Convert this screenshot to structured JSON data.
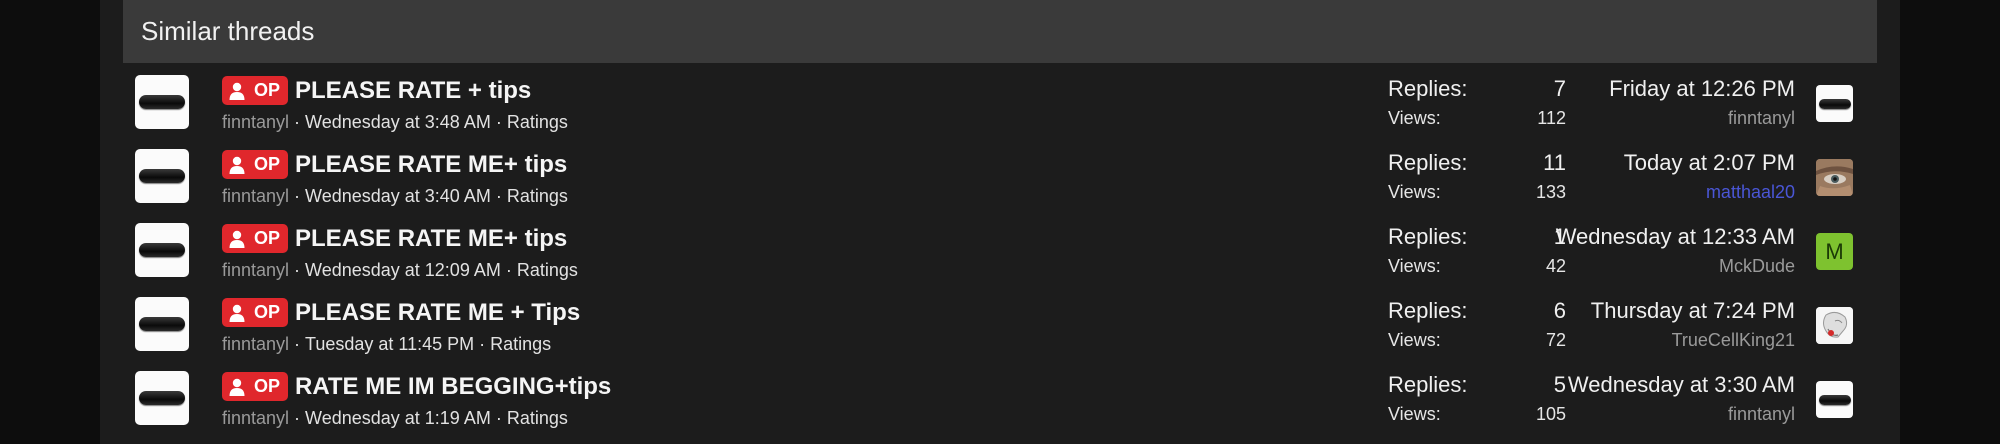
{
  "block": {
    "title": "Similar threads"
  },
  "badge_text": "OP",
  "labels": {
    "replies": "Replies:",
    "views": "Views:"
  },
  "colors": {
    "badge": "#e0272c",
    "highlight_user": "#4a56d6",
    "avatar_letter_bg": "#7ec22f"
  },
  "threads": [
    {
      "title": "PLEASE RATE + tips",
      "author": "finntanyl",
      "date": "Wednesday at 3:48 AM",
      "forum": "Ratings",
      "replies": "7",
      "views": "112",
      "last_date": "Friday at 12:26 PM",
      "last_user": "finntanyl",
      "last_avatar": "pill-image"
    },
    {
      "title": "PLEASE RATE ME+ tips",
      "author": "finntanyl",
      "date": "Wednesday at 3:40 AM",
      "forum": "Ratings",
      "replies": "11",
      "views": "133",
      "last_date": "Today at 2:07 PM",
      "last_user": "matthaal20",
      "last_avatar": "eye-photo"
    },
    {
      "title": "PLEASE RATE ME+ tips",
      "author": "finntanyl",
      "date": "Wednesday at 12:09 AM",
      "forum": "Ratings",
      "replies": "1",
      "views": "42",
      "last_date": "Wednesday at 12:33 AM",
      "last_user": "MckDude",
      "last_avatar": "letter",
      "last_avatar_letter": "M"
    },
    {
      "title": "PLEASE RATE ME + Tips",
      "author": "finntanyl",
      "date": "Tuesday at 11:45 PM",
      "forum": "Ratings",
      "replies": "6",
      "views": "72",
      "last_date": "Thursday at 7:24 PM",
      "last_user": "TrueCellKing21",
      "last_avatar": "skull-image"
    },
    {
      "title": "RATE ME IM BEGGING+tips",
      "author": "finntanyl",
      "date": "Wednesday at 1:19 AM",
      "forum": "Ratings",
      "replies": "5",
      "views": "105",
      "last_date": "Wednesday at 3:30 AM",
      "last_user": "finntanyl",
      "last_avatar": "pill-image"
    }
  ]
}
